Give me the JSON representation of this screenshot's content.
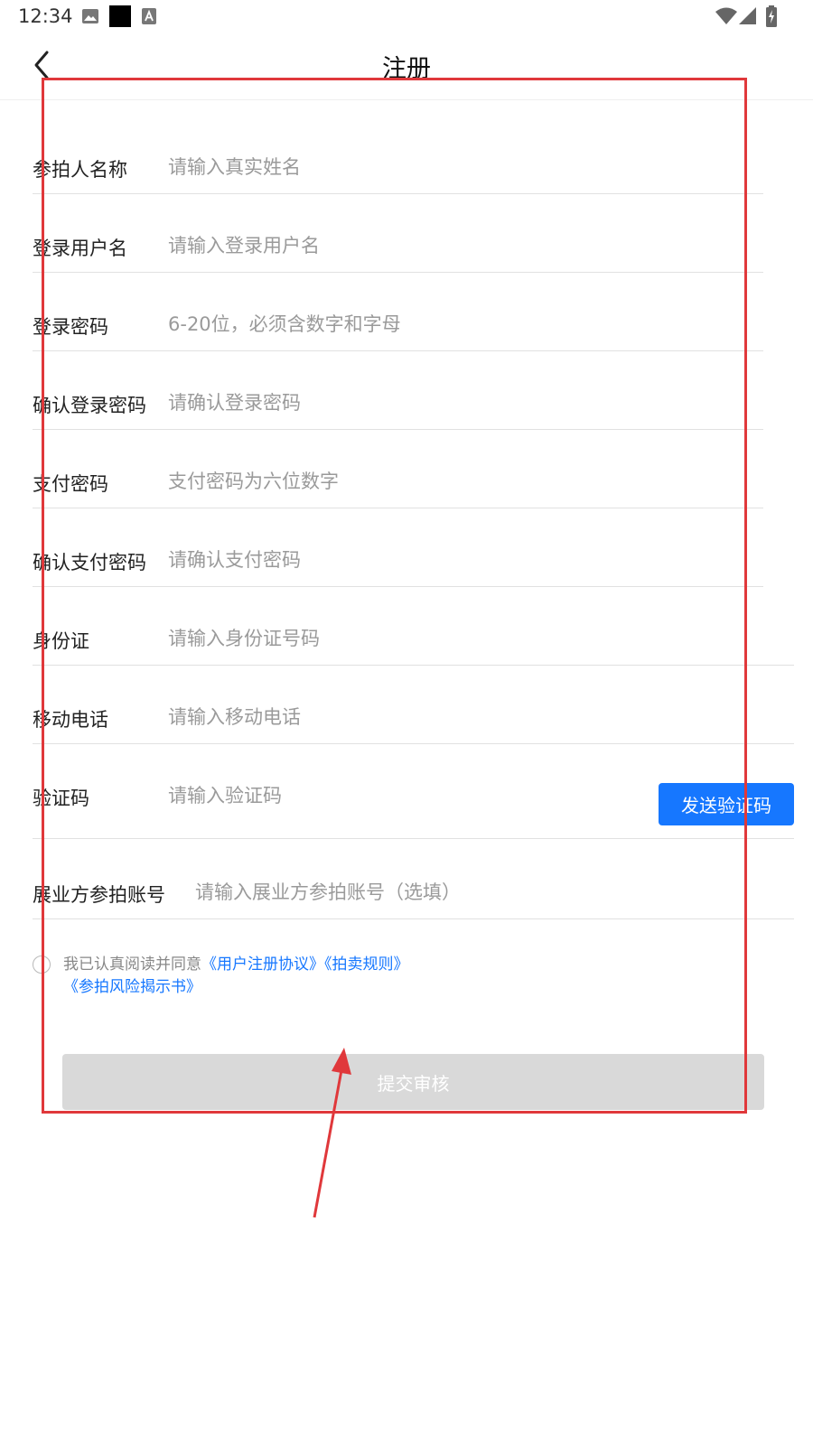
{
  "status_bar": {
    "time": "12:34",
    "icons": [
      "image-icon",
      "black-square-icon",
      "text-a-icon",
      "wifi-icon",
      "cellular-signal-icon",
      "battery-charging-icon"
    ]
  },
  "header": {
    "title": "注册",
    "back_icon": "chevron-left-icon"
  },
  "form": {
    "rows": [
      {
        "label": "参拍人名称",
        "placeholder": "请输入真实姓名"
      },
      {
        "label": "登录用户名",
        "placeholder": "请输入登录用户名"
      },
      {
        "label": "登录密码",
        "placeholder": "6-20位，必须含数字和字母"
      },
      {
        "label": "确认登录密码",
        "placeholder": "请确认登录密码"
      },
      {
        "label": "支付密码",
        "placeholder": "支付密码为六位数字"
      },
      {
        "label": "确认支付密码",
        "placeholder": "请确认支付密码"
      },
      {
        "label": "身份证",
        "placeholder": "请输入身份证号码"
      },
      {
        "label": "移动电话",
        "placeholder": "请输入移动电话"
      },
      {
        "label": "验证码",
        "placeholder": "请输入验证码"
      },
      {
        "label": "展业方参拍账号",
        "placeholder": "请输入展业方参拍账号（选填）"
      }
    ],
    "send_code_label": "发送验证码"
  },
  "agreement": {
    "prefix": "我已认真阅读并同意",
    "links": [
      "《用户注册协议》",
      "《拍卖规则》",
      "《参拍风险揭示书》"
    ],
    "checked": false
  },
  "submit": {
    "label": "提交审核",
    "enabled": false
  },
  "colors": {
    "accent": "#1677ff",
    "annotation": "#e0383b",
    "submit_disabled": "#d9d9d9",
    "placeholder": "#9a9a9a"
  }
}
